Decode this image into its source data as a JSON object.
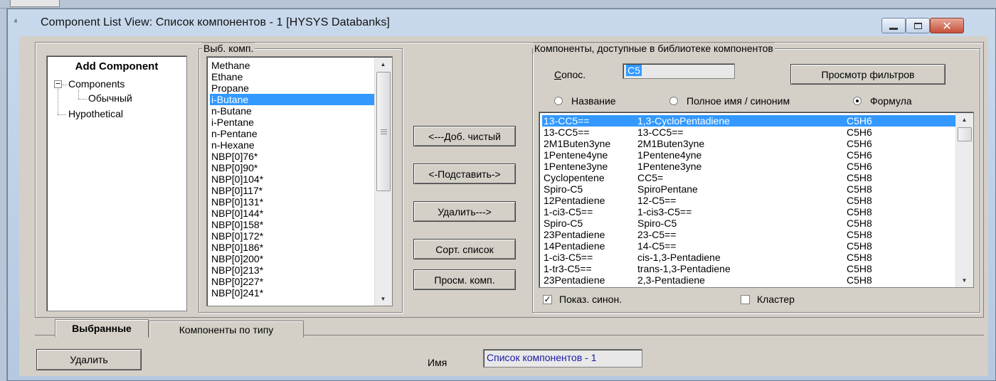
{
  "window": {
    "title": "Component List View: Список компонентов - 1 [HYSYS Databanks]",
    "icon": "app-icon"
  },
  "tree": {
    "title": "Add Component",
    "items": [
      {
        "label": "Components",
        "expanded": true
      },
      {
        "label": "Обычный"
      },
      {
        "label": "Hypothetical"
      }
    ]
  },
  "selected_components": {
    "group_label": "Выб. комп.",
    "items": [
      "Methane",
      "Ethane",
      "Propane",
      "i-Butane",
      "n-Butane",
      "i-Pentane",
      "n-Pentane",
      "n-Hexane",
      "NBP[0]76*",
      "NBP[0]90*",
      "NBP[0]104*",
      "NBP[0]117*",
      "NBP[0]131*",
      "NBP[0]144*",
      "NBP[0]158*",
      "NBP[0]172*",
      "NBP[0]186*",
      "NBP[0]200*",
      "NBP[0]213*",
      "NBP[0]227*",
      "NBP[0]241*"
    ],
    "selected": "i-Butane"
  },
  "actions": {
    "add_pure": "<---Доб. чистый",
    "substitute": "<-Подставить->",
    "remove": "Удалить--->",
    "sort_list": "Сорт. список",
    "view_component": "Просм. комп."
  },
  "library": {
    "group_label": "Компоненты, доступные в библиотеке компонентов",
    "match_label": "Сопос.",
    "match_value": "C5",
    "view_filters": "Просмотр фильтров",
    "radio_name": "Название",
    "radio_fullname": "Полное имя / синоним",
    "radio_formula": "Формула",
    "selected_radio": "formula",
    "components": [
      {
        "name": "13-CC5==",
        "full": "1,3-CycloPentadiene",
        "formula": "C5H6"
      },
      {
        "name": "13-CC5==",
        "full": "13-CC5==",
        "formula": "C5H6"
      },
      {
        "name": "2M1Buten3yne",
        "full": "2M1Buten3yne",
        "formula": "C5H6"
      },
      {
        "name": "1Pentene4yne",
        "full": "1Pentene4yne",
        "formula": "C5H6"
      },
      {
        "name": "1Pentene3yne",
        "full": "1Pentene3yne",
        "formula": "C5H6"
      },
      {
        "name": "Cyclopentene",
        "full": "CC5=",
        "formula": "C5H8"
      },
      {
        "name": "Spiro-C5",
        "full": "SpiroPentane",
        "formula": "C5H8"
      },
      {
        "name": "12Pentadiene",
        "full": "12-C5==",
        "formula": "C5H8"
      },
      {
        "name": "1-ci3-C5==",
        "full": "1-cis3-C5==",
        "formula": "C5H8"
      },
      {
        "name": "Spiro-C5",
        "full": "Spiro-C5",
        "formula": "C5H8"
      },
      {
        "name": "23Pentadiene",
        "full": "23-C5==",
        "formula": "C5H8"
      },
      {
        "name": "14Pentadiene",
        "full": "14-C5==",
        "formula": "C5H8"
      },
      {
        "name": "1-ci3-C5==",
        "full": "cis-1,3-Pentadiene",
        "formula": "C5H8"
      },
      {
        "name": "1-tr3-C5==",
        "full": "trans-1,3-Pentadiene",
        "formula": "C5H8"
      },
      {
        "name": "23Pentadiene",
        "full": "2,3-Pentadiene",
        "formula": "C5H8"
      }
    ],
    "show_synonyms_label": "Показ. синон.",
    "show_synonyms_checked": true,
    "cluster_label": "Кластер",
    "cluster_checked": false
  },
  "tabs": [
    {
      "label": "Выбранные",
      "active": true
    },
    {
      "label": "Компоненты по типу",
      "active": false
    }
  ],
  "bottom": {
    "delete_label": "Удалить",
    "name_label": "Имя",
    "name_value": "Список компонентов - 1"
  }
}
